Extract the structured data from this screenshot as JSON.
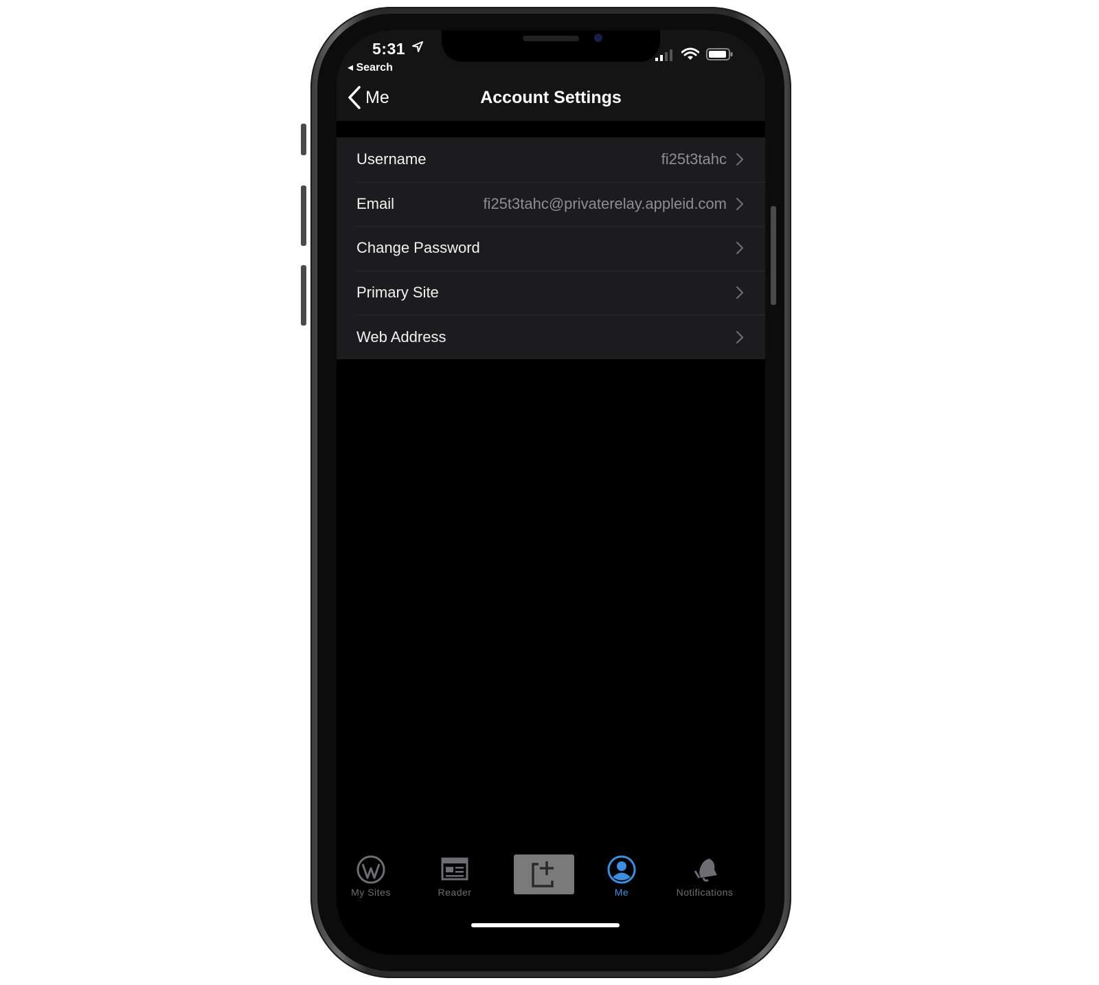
{
  "status_bar": {
    "time": "5:31",
    "back_app": "◂ Search"
  },
  "nav": {
    "back_label": "Me",
    "title": "Account Settings"
  },
  "settings": {
    "rows": [
      {
        "label": "Username",
        "value": "fi25t3tahc"
      },
      {
        "label": "Email",
        "value": "fi25t3tahc@privaterelay.appleid.com"
      },
      {
        "label": "Change Password",
        "value": ""
      },
      {
        "label": "Primary Site",
        "value": ""
      },
      {
        "label": "Web Address",
        "value": ""
      }
    ]
  },
  "tabbar": {
    "my_sites": "My Sites",
    "reader": "Reader",
    "me": "Me",
    "notifications": "Notifications",
    "active": "me"
  },
  "icons": {
    "back": "chevron-left-icon",
    "row_disclosure": "chevron-right-icon",
    "my_sites": "wordpress-icon",
    "reader": "reader-icon",
    "new_post": "new-post-icon",
    "me": "user-icon",
    "notifications": "bell-icon",
    "location": "location-arrow-icon",
    "signal": "signal-icon",
    "wifi": "wifi-icon",
    "battery": "battery-icon"
  },
  "colors": {
    "accent": "#3c8fe0",
    "background": "#000000",
    "row_background": "#1c1c1e",
    "secondary_text": "#8e8e93"
  }
}
